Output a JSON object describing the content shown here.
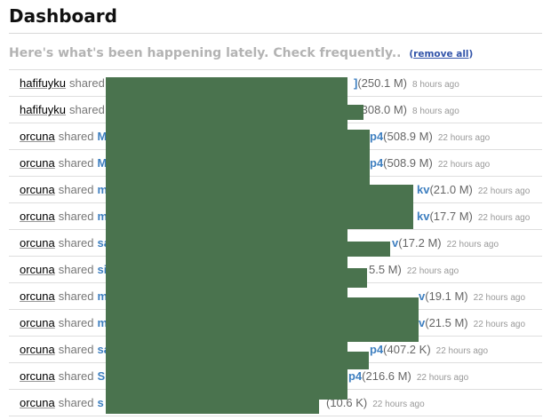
{
  "page": {
    "title": "Dashboard",
    "intro": "Here's what's been happening lately. Check frequently..",
    "remove_all_open": "(",
    "remove_all": "remove all",
    "remove_all_close": ")"
  },
  "feed": [
    {
      "user": "hafifuyku",
      "verb": "shared",
      "file_start": "",
      "file_end": "]",
      "size": "(250.1 M)",
      "time": "8 hours ago"
    },
    {
      "user": "hafifuyku",
      "verb": "shared",
      "file_start": "",
      "file_end": "]",
      "size": "(308.0 M)",
      "time": "8 hours ago"
    },
    {
      "user": "orcuna",
      "verb": "shared",
      "file_start": "M",
      "file_end": "p4",
      "size": "(508.9 M)",
      "time": "22 hours ago"
    },
    {
      "user": "orcuna",
      "verb": "shared",
      "file_start": "M",
      "file_end": "p4",
      "size": "(508.9 M)",
      "time": "22 hours ago"
    },
    {
      "user": "orcuna",
      "verb": "shared",
      "file_start": "m",
      "file_end": "kv",
      "size": "(21.0 M)",
      "time": "22 hours ago"
    },
    {
      "user": "orcuna",
      "verb": "shared",
      "file_start": "m",
      "file_end": "kv",
      "size": "(17.7 M)",
      "time": "22 hours ago"
    },
    {
      "user": "orcuna",
      "verb": "shared",
      "file_start": "sa",
      "file_end": "v",
      "size": "(17.2 M)",
      "time": "22 hours ago"
    },
    {
      "user": "orcuna",
      "verb": "shared",
      "file_start": "si",
      "file_end": "",
      "size": "5.5 M)",
      "time": "22 hours ago"
    },
    {
      "user": "orcuna",
      "verb": "shared",
      "file_start": "m",
      "file_end": "v",
      "size": "(19.1 M)",
      "time": "22 hours ago"
    },
    {
      "user": "orcuna",
      "verb": "shared",
      "file_start": "m",
      "file_end": "v",
      "size": "(21.5 M)",
      "time": "22 hours ago"
    },
    {
      "user": "orcuna",
      "verb": "shared",
      "file_start": "sa",
      "file_end": "p4",
      "size": "(407.2 K)",
      "time": "22 hours ago"
    },
    {
      "user": "orcuna",
      "verb": "shared",
      "file_start": "Sl",
      "file_end": "p4",
      "size": "(216.6 M)",
      "time": "22 hours ago"
    },
    {
      "user": "orcuna",
      "verb": "shared",
      "file_start": "s",
      "file_end": "",
      "size": "(10.6 K)",
      "time": "22 hours ago"
    }
  ],
  "colors": {
    "link": "#3e7fc0",
    "redaction": "#4a734e"
  }
}
